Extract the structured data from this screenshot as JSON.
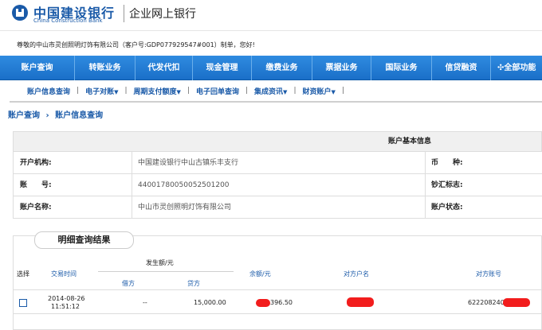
{
  "header": {
    "bank_name_cn": "中国建设银行",
    "bank_name_en": "China Construction Bank",
    "product_name": "企业网上银行",
    "logo_icon": "ccb-logo-icon",
    "brand_color": "#1a5aa8"
  },
  "welcome": {
    "text": "尊敬的中山市灵创照明灯饰有限公司（客户号:GDP077929547#001）制单，您好!"
  },
  "main_nav": {
    "items": [
      {
        "label": "账户查询"
      },
      {
        "label": "转账业务"
      },
      {
        "label": "代发代扣"
      },
      {
        "label": "现金管理"
      },
      {
        "label": "缴费业务"
      },
      {
        "label": "票据业务"
      },
      {
        "label": "国际业务"
      },
      {
        "label": "信贷融资"
      },
      {
        "label": "全部功能"
      }
    ],
    "all_icon": "grid-icon"
  },
  "sub_nav": {
    "items": [
      {
        "label": "账户信息查询",
        "has_menu": false
      },
      {
        "label": "电子对账",
        "has_menu": true
      },
      {
        "label": "周期支付额度",
        "has_menu": true
      },
      {
        "label": "电子回单查询",
        "has_menu": false
      },
      {
        "label": "集成资讯",
        "has_menu": true
      },
      {
        "label": "财资账户",
        "has_menu": true
      }
    ],
    "separator": "|",
    "menu_icon": "caret-down-icon"
  },
  "breadcrumb": {
    "root": "账户查询",
    "separator": "›",
    "current": "账户信息查询"
  },
  "account_info": {
    "title": "账户基本信息",
    "institution_label": "开户机构:",
    "institution_value": "中国建设银行中山古镇乐丰支行",
    "currency_label": "币　　种:",
    "account_label": "账　　号:",
    "account_value": "44001780050052501200",
    "cash_remit_label": "钞汇标志:",
    "name_label": "账户名称:",
    "name_value": "中山市灵创照明灯饰有限公司",
    "status_label": "账户状态:"
  },
  "results": {
    "tab_title": "明细查询结果",
    "columns": {
      "select": "选择",
      "time": "交易时间",
      "amount_group": "发生额/元",
      "debit": "借方",
      "credit": "贷方",
      "balance": "余额/元",
      "counterparty_name": "对方户名",
      "counterparty_account": "对方账号"
    },
    "rows": [
      {
        "date": "2014-08-26",
        "time": "11:51:12",
        "debit": "--",
        "credit": "15,000.00",
        "balance_visible": "396.50",
        "counterparty_name_visible": "",
        "counterparty_account_visible": "622208240200"
      }
    ],
    "redaction_color": "#f21d1d"
  }
}
